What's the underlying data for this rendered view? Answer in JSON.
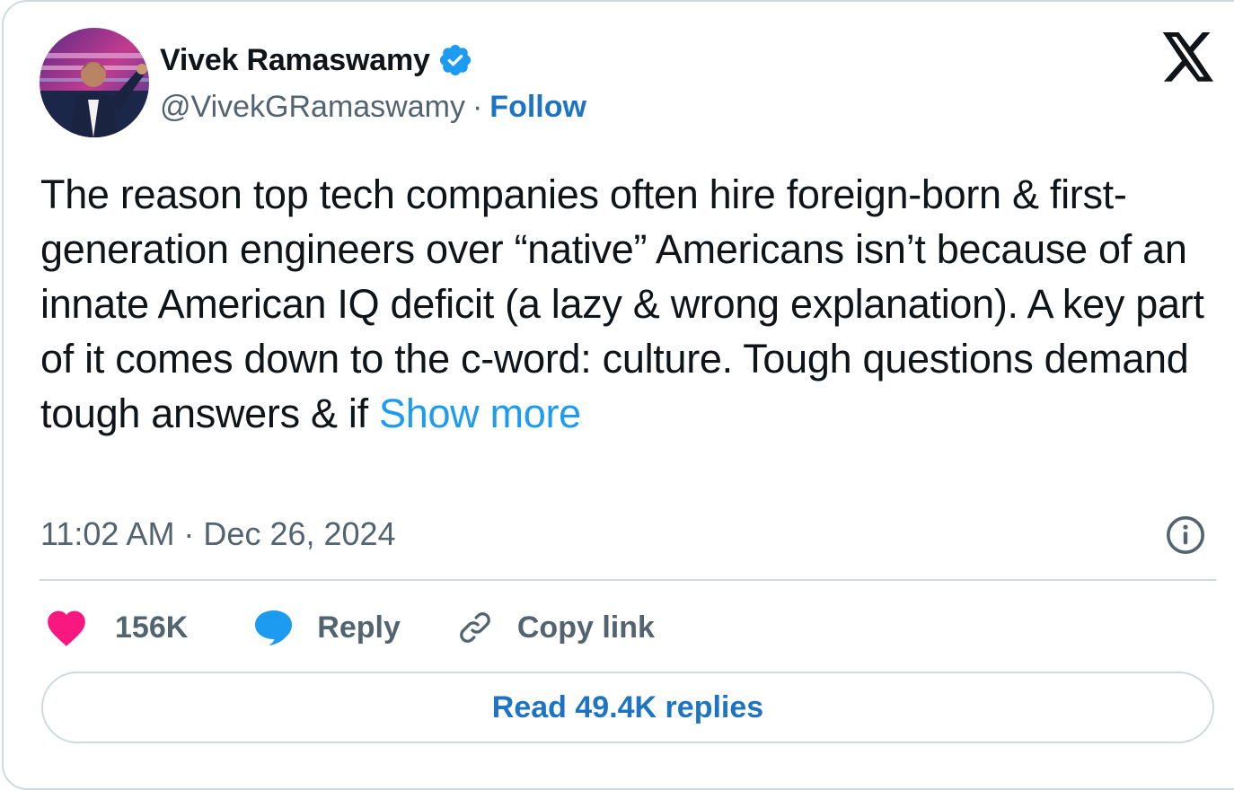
{
  "author": {
    "name": "Vivek Ramaswamy",
    "handle": "@VivekGRamaswamy",
    "separator": "·",
    "follow_label": "Follow",
    "verified": true
  },
  "tweet": {
    "text": "The reason top tech companies often hire foreign-born & first-generation engineers over “native” Americans isn’t because of an innate American IQ deficit (a lazy & wrong explanation). A key part of it comes down to the c-word: culture. Tough questions demand tough answers & if ",
    "show_more_label": "Show more",
    "timestamp": "11:02 AM · Dec 26, 2024"
  },
  "actions": {
    "likes": "156K",
    "reply_label": "Reply",
    "copy_link_label": "Copy link",
    "read_replies_label": "Read 49.4K replies"
  },
  "colors": {
    "link_blue": "#1d74c4",
    "show_more_blue": "#1d9bf0",
    "heart_pink": "#f91880",
    "reply_bubble_blue": "#1d9bf0",
    "verified_blue": "#1d9bf0",
    "border_gray": "#cfd9de",
    "muted_text": "#536471"
  },
  "icons": {
    "logo": "x-logo-icon",
    "verified": "verified-badge-icon",
    "info": "info-icon",
    "like": "heart-icon",
    "reply": "reply-bubble-icon",
    "copy": "link-icon"
  }
}
